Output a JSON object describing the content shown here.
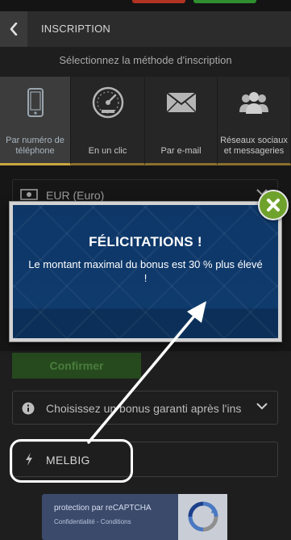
{
  "header": {
    "title": "INSCRIPTION"
  },
  "subtitle": "Sélectionnez la méthode d'inscription",
  "tabs": [
    {
      "label": "Par numéro de téléphone",
      "icon": "phone-icon",
      "active": true
    },
    {
      "label": "En un clic",
      "icon": "speedometer-icon",
      "active": false
    },
    {
      "label": "Par e-mail",
      "icon": "envelope-icon",
      "active": false
    },
    {
      "label": "Réseaux sociaux et messageries",
      "icon": "people-icon",
      "active": false
    }
  ],
  "form": {
    "currency": "EUR (Euro)",
    "confirm_label": "Confirmer",
    "bonus_placeholder": "Choisissez un bonus garanti après l'ins",
    "promo_code": "MELBIG"
  },
  "recaptcha": {
    "title": "protection par reCAPTCHA",
    "links": "Confidentialité - Conditions"
  },
  "modal": {
    "title": "FÉLICITATIONS !",
    "message": "Le montant maximal du bonus est 30 % plus élevé !"
  },
  "colors": {
    "background": "#1e1e1e",
    "header": "#2c2c2c",
    "modal_blue": "#0f3a6c",
    "close_green": "#6fa22c",
    "confirm_green": "#264a1e",
    "tab_underline": "#c9a640",
    "annotation": "#ffffff"
  }
}
